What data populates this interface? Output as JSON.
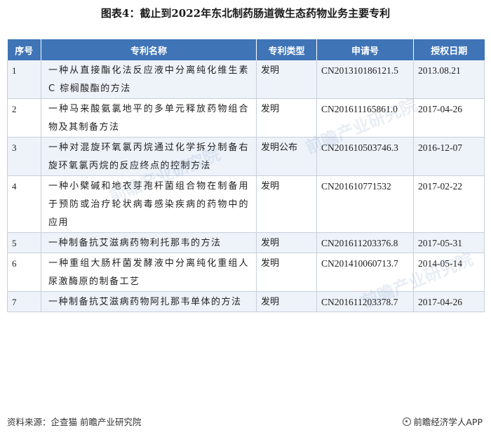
{
  "title": "图表4：截止到2022年东北制药肠道微生态药物业务主要专利",
  "table": {
    "headers": [
      "序号",
      "专利名称",
      "专利类型",
      "申请号",
      "授权日期"
    ],
    "rows": [
      {
        "no": "1",
        "name": "一种从直接酯化法反应液中分离纯化维生素 C 棕榈酸酯的方法",
        "type": "发明",
        "app_no": "CN201310186121.5",
        "date": "2013.08.21"
      },
      {
        "no": "2",
        "name": "一种马来酸氨氯地平的多单元释放药物组合物及其制备方法",
        "type": "发明",
        "app_no": "CN201611165861.0",
        "date": "2017-04-26"
      },
      {
        "no": "3",
        "name": "一种对混旋环氧氯丙烷通过化学拆分制备右旋环氧氯丙烷的反应终点的控制方法",
        "type": "发明公布",
        "app_no": "CN201610503746.3",
        "date": "2016-12-07"
      },
      {
        "no": "4",
        "name": "一种小檗碱和地衣芽孢杆菌组合物在制备用于预防或治疗轮状病毒感染疾病的药物中的应用",
        "type": "发明",
        "app_no": "CN201610771532",
        "date": "2017-02-22"
      },
      {
        "no": "5",
        "name": "一种制备抗艾滋病药物利托那韦的方法",
        "type": "发明",
        "app_no": "CN201611203376.8",
        "date": "2017-05-31"
      },
      {
        "no": "6",
        "name": "一种重组大肠杆菌发酵液中分离纯化重组人尿激酶原的制备工艺",
        "type": "发明",
        "app_no": "CN201410060713.7",
        "date": "2014-05-14"
      },
      {
        "no": "7",
        "name": "一种制备抗艾滋病药物阿扎那韦单体的方法",
        "type": "发明",
        "app_no": "CN201611203378.7",
        "date": "2017-04-26"
      }
    ]
  },
  "watermark_text": "前瞻产业研究院",
  "footer": {
    "source": "资料来源：企查猫 前瞻产业研究院",
    "app_icon": "qianzhan-logo-icon",
    "brand": "前瞻经济学人APP"
  }
}
